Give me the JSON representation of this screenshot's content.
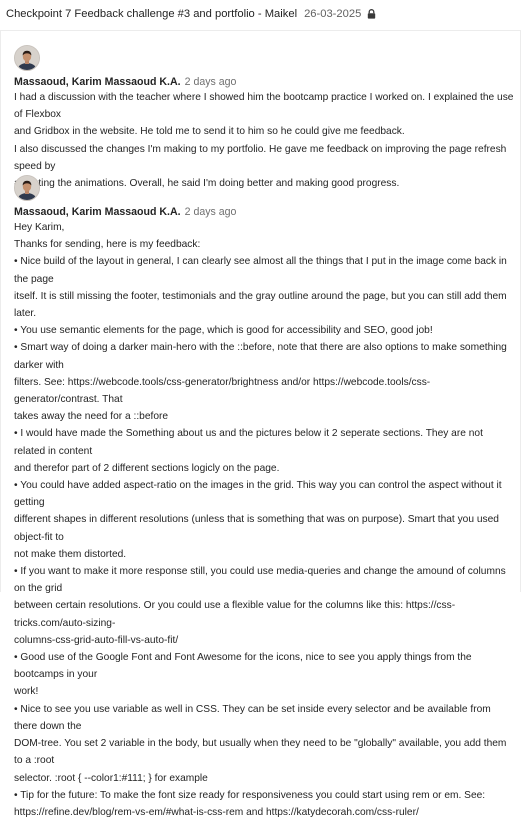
{
  "header": {
    "title": "Checkpoint 7  Feedback challenge #3 and portfolio - Maikel",
    "date": "26-03-2025",
    "lock_icon": "lock-icon"
  },
  "messages": [
    {
      "author": "Massaoud, Karim Massaoud K.A.",
      "time": "2 days ago",
      "avatar_icon": "avatar-photo",
      "lines": [
        "I had a discussion with the teacher where I showed him the bootcamp practice I worked on. I explained the use of Flexbox",
        "and Gridbox in the website. He told me to send it to him so he could give me feedback.",
        "I also discussed the changes I'm making to my portfolio. He gave me feedback on improving the page refresh speed by",
        "adjusting the animations. Overall, he said I'm doing better and making good progress."
      ]
    },
    {
      "author": "Massaoud, Karim Massaoud K.A.",
      "time": "2 days ago",
      "avatar_icon": "avatar-photo",
      "lines": [
        "Hey Karim,",
        "Thanks for sending, here is my feedback:",
        "• Nice build of the layout in general, I can clearly see almost all the things that I put in the image come back in the page",
        "itself. It is still missing the footer, testimonials and the gray outline around the page, but you can still add them later.",
        "• You use semantic elements for the page, which is good for accessibility and SEO, good job!",
        "• Smart way of doing a darker main-hero with the ::before, note that there are also options to make something darker with",
        "filters. See: https://webcode.tools/css-generator/brightness and/or https://webcode.tools/css-generator/contrast. That",
        "takes away the need for a ::before",
        "• I would have made the Something about us and the pictures below it 2 seperate sections. They are not related in content",
        "and therefor part of 2 different sections logicly on the page.",
        "• You could have added aspect-ratio on the images in the grid. This way you can control the aspect without it getting",
        "different shapes in different resolutions (unless that is something that was on purpose). Smart that you used object-fit to",
        "not make them distorted.",
        "• If you want to make it more response still, you could use media-queries and change the amound of columns on the grid",
        "between certain resolutions. Or you could use a flexible value for the columns like this: https://css-tricks.com/auto-sizing-",
        "columns-css-grid-auto-fill-vs-auto-fit/",
        "• Good use of the Google Font and Font Awesome for the icons, nice to see you apply things from the bootcamps in your",
        "work!",
        "• Nice to see you use variable as well in CSS. They can be set inside every selector and be available from there down the",
        "DOM-tree. You set 2 variable in the body, but usually when they need to be \"globally\" available, you add them to a :root",
        "selector. :root { --color1:#111;  } for example",
        "• Tip for the future: To make the font size ready for responsiveness you could start using rem or em. See:",
        "https://refine.dev/blog/rem-vs-em/#what-is-css-rem and https://katydecorah.com/css-ruler/"
      ]
    }
  ]
}
